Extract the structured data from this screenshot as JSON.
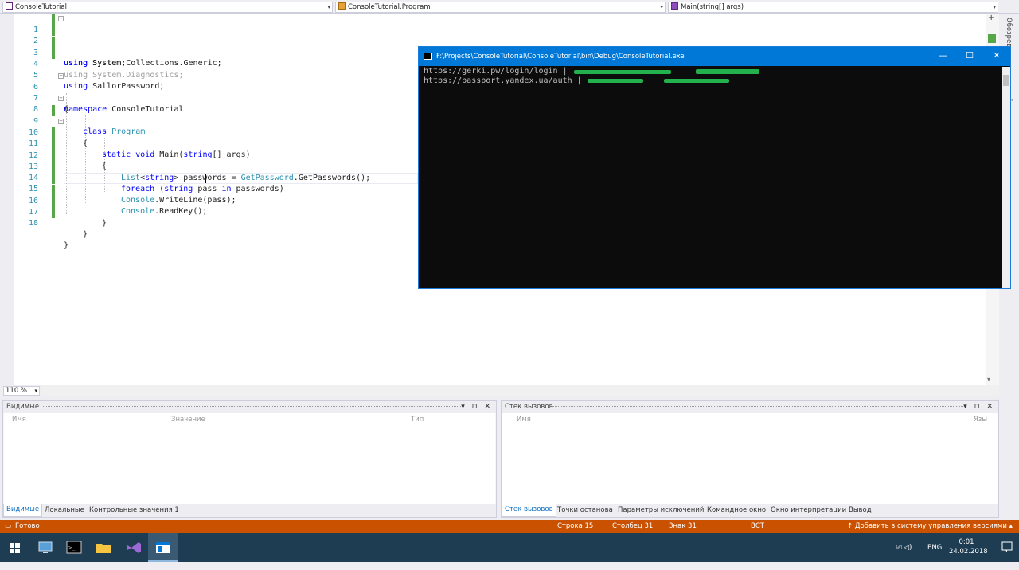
{
  "nav": {
    "project": "ConsoleTutorial",
    "class": "ConsoleTutorial.Program",
    "member": "Main(string[] args)"
  },
  "side_tab": "Обозреватель решений",
  "code_lines": [
    {
      "n": "1"
    },
    {
      "n": "2"
    },
    {
      "n": "3"
    },
    {
      "n": "4"
    },
    {
      "n": "5"
    },
    {
      "n": "6"
    },
    {
      "n": "7"
    },
    {
      "n": "8"
    },
    {
      "n": "9"
    },
    {
      "n": "10"
    },
    {
      "n": "11"
    },
    {
      "n": "12"
    },
    {
      "n": "13"
    },
    {
      "n": "14"
    },
    {
      "n": "15"
    },
    {
      "n": "16"
    },
    {
      "n": "17"
    },
    {
      "n": "18"
    }
  ],
  "code": {
    "using": "using",
    "ns_system": " System;",
    "ns_generic": " System.Collections.Generic;",
    "l3": "using System.Diagnostics;",
    "ns_sallor": " SallorPassword;",
    "namespace_kw": "namespace",
    "namespace_name": " ConsoleTutorial",
    "brace_open": "{",
    "brace_close": "}",
    "class_kw": "class",
    "class_name": "Program",
    "static_void": "static void",
    "main_sig": " Main(",
    "string_kw": "string",
    "main_args": "[] args)",
    "list_type": "List",
    "lt": "<",
    "gt": ">",
    "passwords_assign": " passwords = ",
    "getpassword": "GetPassword",
    "getpasswords_call": ".GetPasswords();",
    "foreach_kw": "foreach",
    "paren_open": " (",
    "pass_kw": " pass ",
    "in_kw": "in",
    "passwords_close": " passwords)",
    "console": "Console",
    "writeline": ".WriteLine(pass);",
    "readkey": ".ReadKey();"
  },
  "zoom": "110 %",
  "panel_left": {
    "title": "Видимые",
    "cols": [
      "Имя",
      "Значение",
      "Тип"
    ],
    "tabs": [
      "Видимые",
      "Локальные",
      "Контрольные значения 1"
    ]
  },
  "panel_right": {
    "title": "Стек вызовов",
    "cols": [
      "Имя",
      "Язы"
    ],
    "tabs": [
      "Стек вызовов",
      "Точки останова",
      "Параметры исключений",
      "Командное окно",
      "Окно интерпретации",
      "Вывод"
    ]
  },
  "panel_ctrls": "▾ ⊓ ✕",
  "status": {
    "ready": "Готово",
    "line": "Строка 15",
    "col": "Столбец 31",
    "ch": "Знак 31",
    "ins": "ВСТ",
    "vcs": "↑ Добавить в систему управления версиями ▴"
  },
  "console": {
    "title": "F:\\Projects\\ConsoleTutorial\\ConsoleTutorial\\bin\\Debug\\ConsoleTutorial.exe",
    "line1": "https://gerki.pw/login/login | ",
    "line2": "https://passport.yandex.ua/auth | ",
    "min": "—",
    "max": "☐",
    "close": "✕"
  },
  "taskbar": {
    "lang": "ENG",
    "time": "0:01",
    "date": "24.02.2018",
    "tray_icons": "⎚ ◁)"
  },
  "colors": {
    "status_bg": "#ca5100",
    "console_title_bg": "#0078d7",
    "redaction": "#22b14c",
    "taskbar_bg": "#1f3d52"
  }
}
